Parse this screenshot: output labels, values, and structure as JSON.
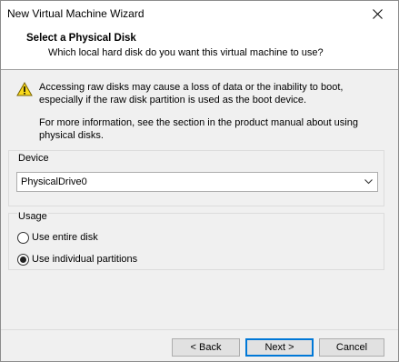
{
  "window": {
    "title": "New Virtual Machine Wizard"
  },
  "header": {
    "title": "Select a Physical Disk",
    "subtitle": "Which local hard disk do you want this virtual machine to use?"
  },
  "warning": {
    "line1": "Accessing raw disks may cause a loss of data or the inability to boot,",
    "line2": "especially if the raw disk partition is used as the boot device.",
    "info_line1": "For more information, see the section in the product manual about using",
    "info_line2": "physical disks."
  },
  "device": {
    "group_label": "Device",
    "selected": "PhysicalDrive0"
  },
  "usage": {
    "group_label": "Usage",
    "options": [
      {
        "label": "Use entire disk",
        "checked": false
      },
      {
        "label": "Use individual partitions",
        "checked": true
      }
    ]
  },
  "buttons": {
    "back": "< Back",
    "next": "Next >",
    "cancel": "Cancel"
  },
  "colors": {
    "accent": "#0078d7",
    "warning_yellow": "#f8d81c"
  }
}
